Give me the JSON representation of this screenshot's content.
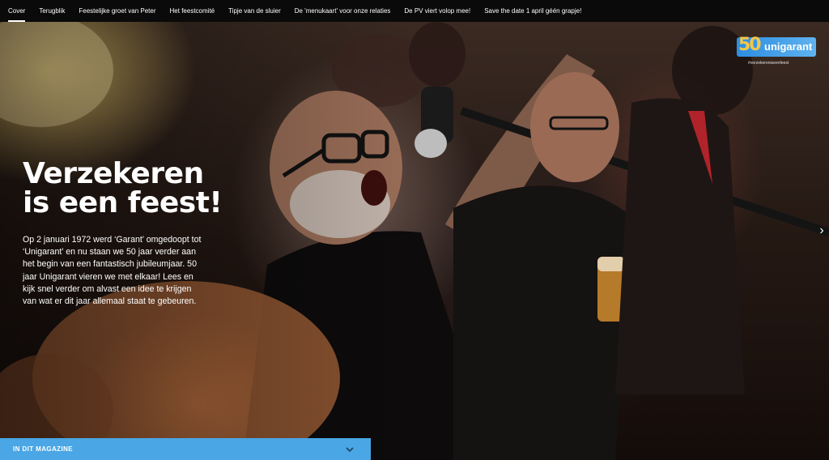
{
  "nav": {
    "items": [
      {
        "label": "Cover",
        "active": true
      },
      {
        "label": "Terugblik",
        "active": false
      },
      {
        "label": "Feestelijke groet van Peter",
        "active": false
      },
      {
        "label": "Het feestcomité",
        "active": false
      },
      {
        "label": "Tipje van de sluier",
        "active": false
      },
      {
        "label": "De 'menukaart' voor onze relaties",
        "active": false
      },
      {
        "label": "De PV viert volop mee!",
        "active": false
      },
      {
        "label": "Save the date 1 april géén grapje!",
        "active": false
      }
    ]
  },
  "logo": {
    "number": "50",
    "name": "unigarant",
    "tagline": "#verzekereniseenfeest"
  },
  "hero": {
    "headline_line1": "Verzekeren",
    "headline_line2": "is een feest!",
    "intro": "Op 2 januari 1972 werd ‘Garant’ omgedoopt tot ‘Unigarant’ en nu staan we 50 jaar verder aan het begin van een fantastisch jubileumjaar. 50 jaar Unigarant vieren we met elkaar! Lees en kijk snel verder om alvast een idee te krijgen van wat er dit jaar allemaal staat te gebeuren."
  },
  "controls": {
    "next_icon": "chevron-right-icon",
    "next_glyph": "›"
  },
  "magazine_bar": {
    "label": "IN DIT MAGAZINE",
    "icon": "chevron-down-icon"
  },
  "colors": {
    "nav_bg": "#0a0a0a",
    "accent_blue": "#4aa6e4",
    "logo_gold": "#f2c74a"
  }
}
